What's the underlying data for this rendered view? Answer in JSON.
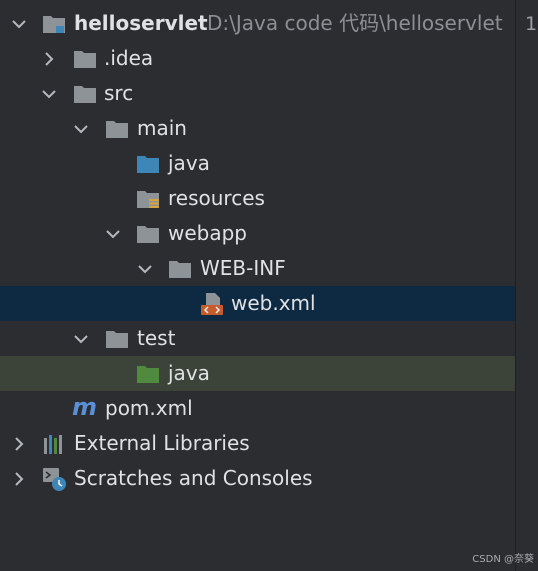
{
  "tree": {
    "project": {
      "name": "helloservlet",
      "path": "D:\\Java code 代码\\helloservlet"
    },
    "idea": ".idea",
    "src": "src",
    "main": "main",
    "main_java": "java",
    "resources": "resources",
    "webapp": "webapp",
    "webinf": "WEB-INF",
    "webxml": "web.xml",
    "test": "test",
    "test_java": "java",
    "pom": "pom.xml",
    "external": "External Libraries",
    "scratches": "Scratches and Consoles"
  },
  "gutter": {
    "line_number": "1"
  },
  "watermark": "CSDN @奈葵",
  "colors": {
    "background": "#2b2d30",
    "selection": "#0e2a43",
    "highlight": "#3c4338",
    "folder": "#8e9398",
    "source_folder": "#3e86b8",
    "test_folder": "#4f8a3e",
    "xml_icon": "#c75b2b",
    "maven": "#5a8fd6"
  }
}
